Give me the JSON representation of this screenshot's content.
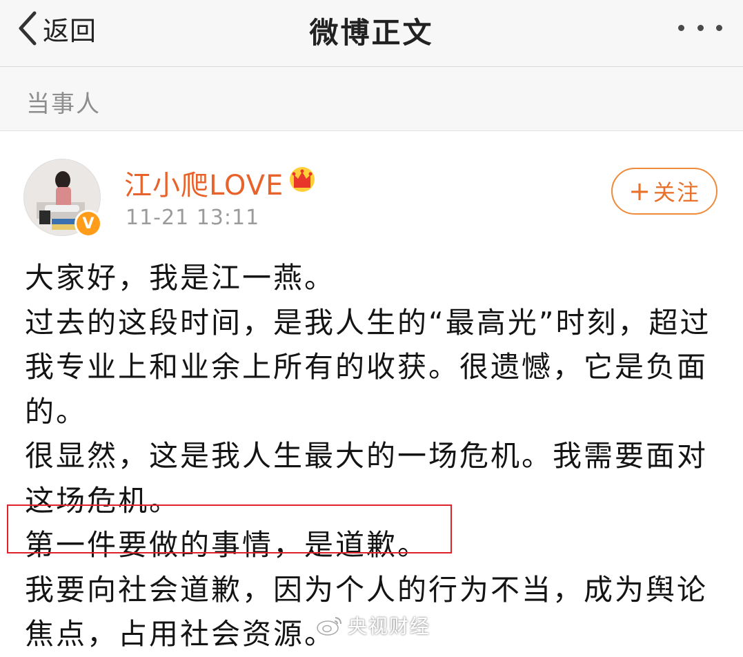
{
  "navbar": {
    "back_label": "返回",
    "title": "微博正文"
  },
  "section": {
    "label": "当事人"
  },
  "post": {
    "username": "江小爬LOVE",
    "timestamp": "11-21 13:11",
    "follow_label": "关注",
    "follow_plus": "+",
    "verified_badge": "V",
    "lines": [
      "大家好，我是江一燕。",
      "过去的这段时间，是我人生的“最高光”时刻，超过",
      "我专业上和业余上所有的收获。很遗憾，它是负面",
      "的。",
      "很显然，这是我人生最大的一场危机。我需要面对",
      "这场危机。",
      "第一件要做的事情，是道歉。",
      "我要向社会道歉，因为个人的行为不当，成为舆论",
      "焦点，占用社会资源。"
    ],
    "highlighted_line_index": 6
  },
  "watermark": {
    "text": "央视财经",
    "icon": "weibo-logo-icon"
  },
  "colors": {
    "username": "#e8632b",
    "follow_border": "#ef8a3a",
    "highlight_box": "#e0202a",
    "verified_badge": "#ff9d1b",
    "navbar_bg": "#f7f7f7",
    "section_text": "#8d8d8d"
  },
  "icons": {
    "back": "chevron-left-icon",
    "more": "more-dots-icon",
    "crown": "crown-icon"
  }
}
